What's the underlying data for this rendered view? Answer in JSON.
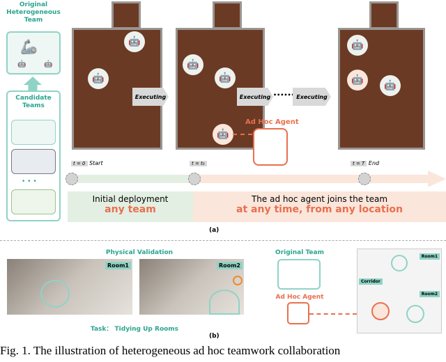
{
  "part_a": {
    "original_team_label": "Original Heterogeneous Team",
    "candidate_teams_label": "Candidate Teams",
    "ellipsis": "• • •",
    "executing": [
      "Executing",
      "Executing",
      "Executing"
    ],
    "dots": "••••••",
    "ad_hoc_agent_label": "Ad Hoc Agent",
    "timeline": {
      "start_badge": "t = 0",
      "start_label": "Start",
      "join_badge": "t = t₀",
      "end_badge": "t = T",
      "end_label": "End"
    },
    "initial_deployment": "Initial deployment",
    "any_team": "any team",
    "joins_text": "The ad hoc agent joins the team",
    "any_time_text": "at any time, from any location",
    "caption": "(a)"
  },
  "part_b": {
    "physical_validation": "Physical Validation",
    "room1": "Room1",
    "room2": "Room2",
    "task": "Task： Tidying Up Rooms",
    "original_team": "Original Team",
    "ad_hoc_agent": "Ad Hoc Agent",
    "map_room1": "Room1",
    "map_room2": "Room2",
    "corridor": "Corridor",
    "caption": "(b)"
  },
  "figure_caption": "Fig. 1.   The illustration of heterogeneous ad hoc teamwork collaboration",
  "colors": {
    "teal": "#2aa58f",
    "orange": "#e8704f",
    "green_bg": "#e3efe3",
    "orange_bg": "#fbe6db"
  }
}
